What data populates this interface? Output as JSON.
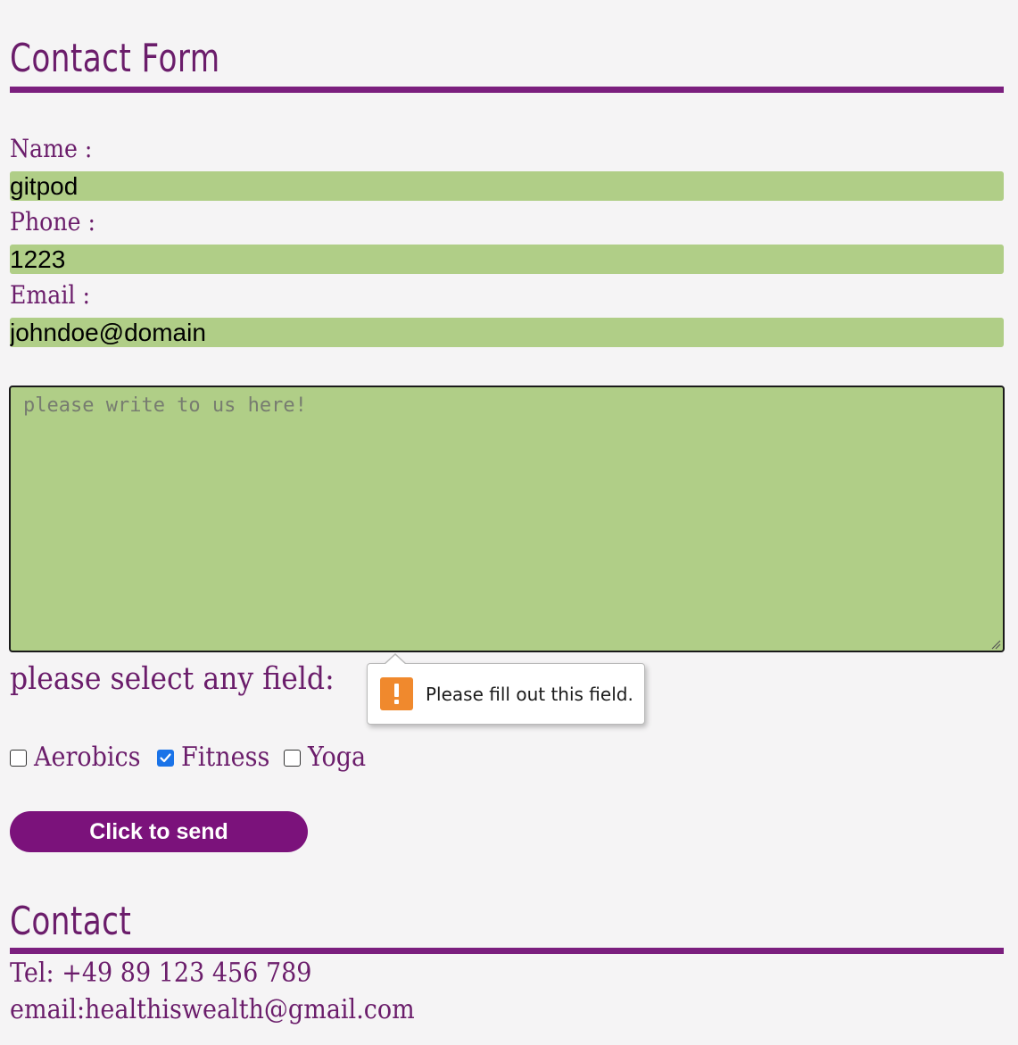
{
  "contact_form": {
    "title": "Contact Form",
    "name": {
      "label": "Name :",
      "value": "gitpod"
    },
    "phone": {
      "label": "Phone :",
      "value": "1223"
    },
    "email": {
      "label": "Email :",
      "value": "johndoe@domain"
    },
    "message": {
      "placeholder": "please write to us here!",
      "value": ""
    },
    "validation_tooltip": {
      "icon": "warning-icon",
      "text": "Please fill out this field.",
      "icon_color": "#f0892d"
    },
    "select_label": "please select any field:",
    "options": [
      {
        "label": "Aerobics",
        "checked": false
      },
      {
        "label": "Fitness",
        "checked": true
      },
      {
        "label": "Yoga",
        "checked": false
      }
    ],
    "send_button": "Click to send"
  },
  "contact": {
    "title": "Contact",
    "tel": "Tel: +49 89 123 456 789",
    "email": "email:healthiswealth@gmail.com"
  },
  "colors": {
    "accent": "#7b1f7e",
    "text": "#6b1d6b",
    "input_background": "#b0ce87",
    "button_background": "#7b127b",
    "page_background": "#f5f4f5"
  }
}
